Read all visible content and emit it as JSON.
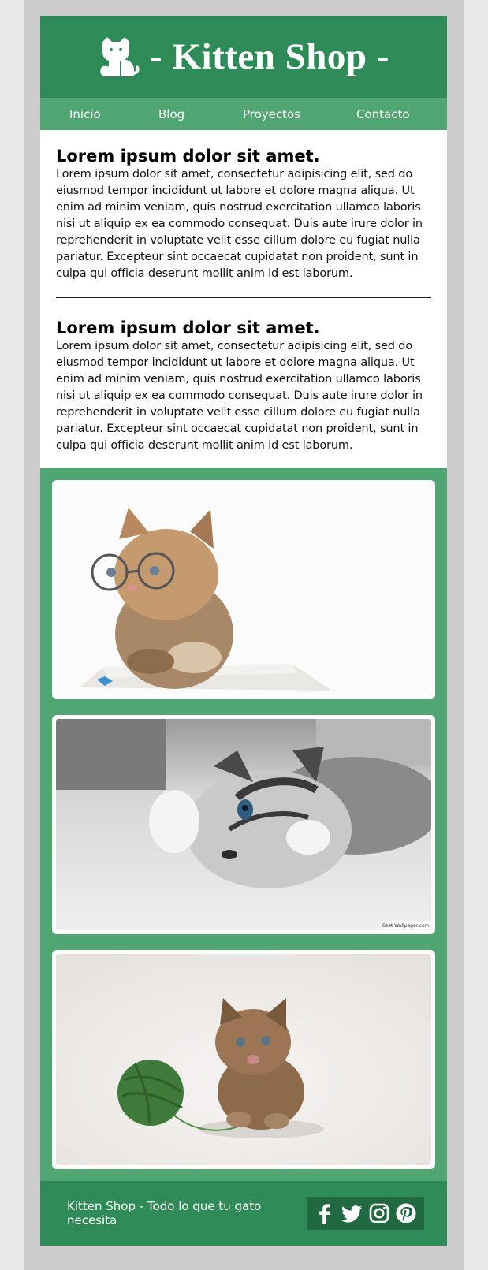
{
  "header": {
    "title": "- Kitten Shop -",
    "logo_icon": "cat-icon"
  },
  "nav": {
    "items": [
      {
        "label": "Inicio"
      },
      {
        "label": "Blog"
      },
      {
        "label": "Proyectos"
      },
      {
        "label": "Contacto"
      }
    ]
  },
  "articles": [
    {
      "heading": "Lorem ipsum dolor sit amet.",
      "body": "Lorem ipsum dolor sit amet, consectetur adipisicing elit, sed do eiusmod tempor incididunt ut labore et dolore magna aliqua. Ut enim ad minim veniam, quis nostrud exercitation ullamco laboris nisi ut aliquip ex ea commodo consequat. Duis aute irure dolor in reprehenderit in voluptate velit esse cillum dolore eu fugiat nulla pariatur. Excepteur sint occaecat cupidatat non proident, sunt in culpa qui officia deserunt mollit anim id est laborum."
    },
    {
      "heading": "Lorem ipsum dolor sit amet.",
      "body": "Lorem ipsum dolor sit amet, consectetur adipisicing elit, sed do eiusmod tempor incididunt ut labore et dolore magna aliqua. Ut enim ad minim veniam, quis nostrud exercitation ullamco laboris nisi ut aliquip ex ea commodo consequat. Duis aute irure dolor in reprehenderit in voluptate velit esse cillum dolore eu fugiat nulla pariatur. Excepteur sint occaecat cupidatat non proident, sunt in culpa qui officia deserunt mollit anim id est laborum."
    }
  ],
  "gallery": {
    "photos": [
      {
        "subject": "kitten-with-glasses-reading"
      },
      {
        "subject": "kitten-lying-on-bed"
      },
      {
        "subject": "kitten-with-yarn-ball"
      }
    ],
    "watermark": "Best Wallpaper.com"
  },
  "footer": {
    "tagline": "Kitten Shop - Todo lo que tu gato necesita",
    "social": [
      "facebook-icon",
      "twitter-icon",
      "instagram-icon",
      "pinterest-icon"
    ]
  },
  "colors": {
    "header_bg": "#2e8b57",
    "nav_bg": "#50a673",
    "footer_social_bg": "#216a41",
    "page_bg": "#cccccc"
  }
}
